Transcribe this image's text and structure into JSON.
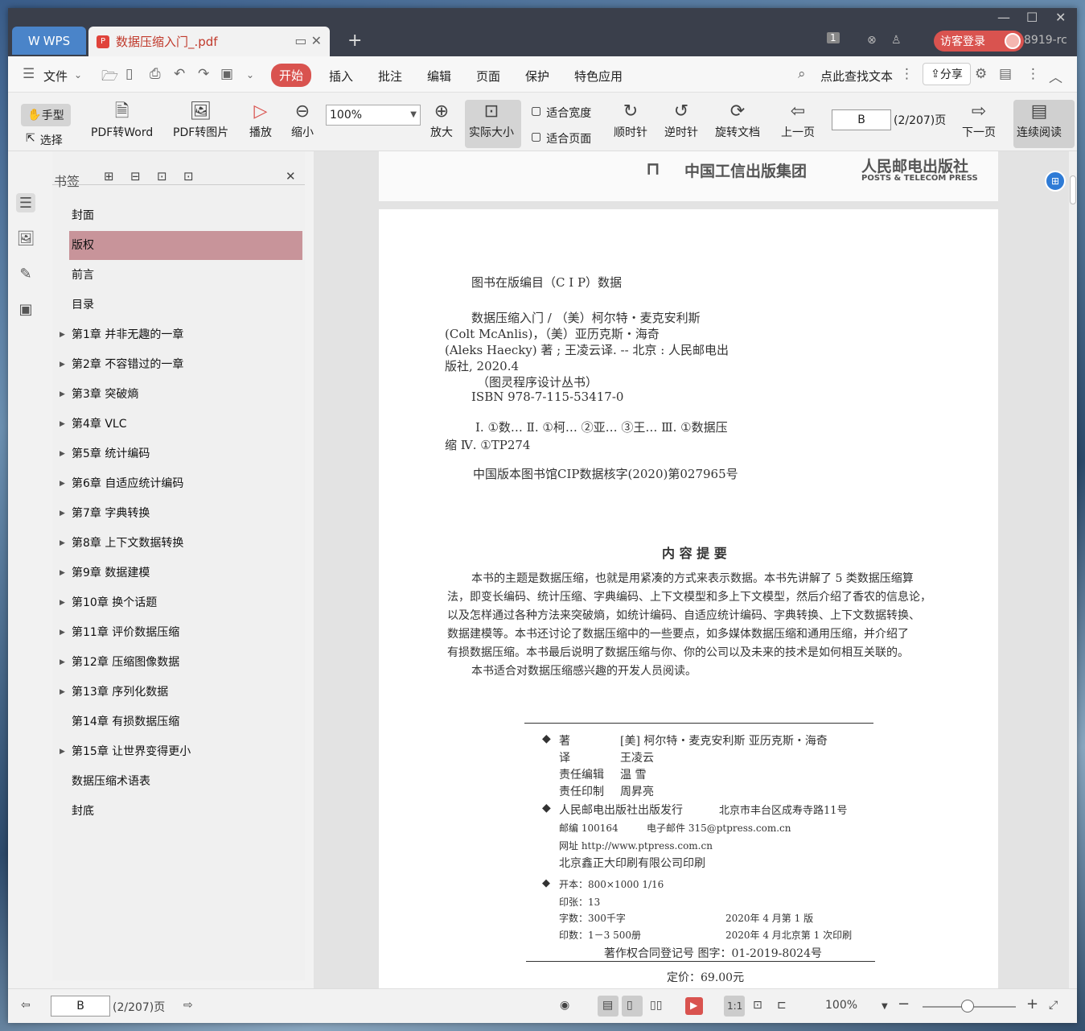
{
  "titlebar": {
    "app_tab": "WPS",
    "doc_tab": "数据压缩入门_.pdf",
    "page_badge": "1",
    "login": "访客登录",
    "user": "8919-rc"
  },
  "menu": {
    "file": "文件",
    "items": [
      "开始",
      "插入",
      "批注",
      "编辑",
      "页面",
      "保护",
      "特色应用"
    ],
    "search": "点此查找文本",
    "share": "分享"
  },
  "toolbar": {
    "hand": "手型",
    "select": "选择",
    "pdf_word": "PDF转Word",
    "pdf_img": "PDF转图片",
    "play": "播放",
    "zoom_out": "缩小",
    "zoom": "100%",
    "zoom_in": "放大",
    "actual": "实际大小",
    "fit_width": "适合宽度",
    "fit_page": "适合页面",
    "cw": "顺时针",
    "ccw": "逆时针",
    "rotate": "旋转文档",
    "prev": "上一页",
    "page": "B",
    "page_total": "(2/207)页",
    "next": "下一页",
    "continuous": "连续阅读"
  },
  "bookmarks": {
    "title": "书签",
    "items": [
      {
        "label": "封面",
        "arrow": false
      },
      {
        "label": "版权",
        "arrow": false,
        "selected": true
      },
      {
        "label": "前言",
        "arrow": false
      },
      {
        "label": "目录",
        "arrow": false
      },
      {
        "label": "第1章 并非无趣的一章",
        "arrow": true
      },
      {
        "label": "第2章 不容错过的一章",
        "arrow": true
      },
      {
        "label": "第3章 突破熵",
        "arrow": true
      },
      {
        "label": "第4章 VLC",
        "arrow": true
      },
      {
        "label": "第5章 统计编码",
        "arrow": true
      },
      {
        "label": "第6章 自适应统计编码",
        "arrow": true
      },
      {
        "label": "第7章 字典转换",
        "arrow": true
      },
      {
        "label": "第8章 上下文数据转换",
        "arrow": true
      },
      {
        "label": "第9章 数据建模",
        "arrow": true
      },
      {
        "label": "第10章 换个话题",
        "arrow": true
      },
      {
        "label": "第11章 评价数据压缩",
        "arrow": true
      },
      {
        "label": "第12章 压缩图像数据",
        "arrow": true
      },
      {
        "label": "第13章 序列化数据",
        "arrow": true
      },
      {
        "label": "第14章 有损数据压缩",
        "arrow": false
      },
      {
        "label": "第15章 让世界变得更小",
        "arrow": true
      },
      {
        "label": "数据压缩术语表",
        "arrow": false
      },
      {
        "label": "封底",
        "arrow": false
      }
    ]
  },
  "prev_page": {
    "pub1": "中国工信出版集团",
    "pub2": "人民邮电出版社",
    "pub2_en": "POSTS & TELECOM PRESS"
  },
  "pdf": {
    "cip_title": "图书在版编目（C I P）数据",
    "cip": [
      "数据压缩入门 / （美）柯尔特・麦克安利斯",
      "(Colt McAnlis)，（美）亚历克斯・海奇",
      "(Aleks Haecky) 著 ; 王凌云译. -- 北京 : 人民邮电出",
      "版社, 2020.4",
      "（图灵程序设计丛书）",
      "ISBN 978-7-115-53417-0"
    ],
    "cls1": "Ⅰ. ①数… Ⅱ. ①柯… ②亚… ③王… Ⅲ. ①数据压",
    "cls2": "缩 Ⅳ. ①TP274",
    "cip_no": "中国版本图书馆CIP数据核字(2020)第027965号",
    "summary_title": "内 容 提 要",
    "summary": [
      "本书的主题是数据压缩，也就是用紧凑的方式来表示数据。本书先讲解了 5 类数据压缩算",
      "法，即变长编码、统计压缩、字典编码、上下文模型和多上下文模型，然后介绍了香农的信息论，",
      "以及怎样通过各种方法来突破熵，如统计编码、自适应统计编码、字典转换、上下文数据转换、",
      "数据建模等。本书还讨论了数据压缩中的一些要点，如多媒体数据压缩和通用压缩，并介绍了",
      "有损数据压缩。本书最后说明了数据压缩与你、你的公司以及未来的技术是如何相互关联的。",
      "本书适合对数据压缩感兴趣的开发人员阅读。"
    ],
    "credits": [
      [
        "◆",
        "著",
        "[美] 柯尔特・麦克安利斯  亚历克斯・海奇"
      ],
      [
        "",
        "译",
        "王凌云"
      ],
      [
        "",
        "责任编辑",
        "温  雪"
      ],
      [
        "",
        "责任印制",
        "周昇亮"
      ]
    ],
    "publisher": "人民邮电出版社出版发行",
    "address": "北京市丰台区成寿寺路11号",
    "postcode": "邮编  100164",
    "email": "电子邮件  315@ptpress.com.cn",
    "web": "网址  http://www.ptpress.com.cn",
    "printer": "北京鑫正大印刷有限公司印刷",
    "format": "开本：800×1000  1/16",
    "sheets": "印张：13",
    "words": "字数：300千字",
    "edition": "2020年 4 月第 1 版",
    "prints": "印数：1－3 500册",
    "printing": "2020年 4 月北京第 1 次印刷",
    "copyright": "著作权合同登记号  图字：01-2019-8024号",
    "price": "定价：69.00元"
  },
  "status": {
    "page": "B",
    "total": "(2/207)页",
    "zoom": "100%"
  }
}
